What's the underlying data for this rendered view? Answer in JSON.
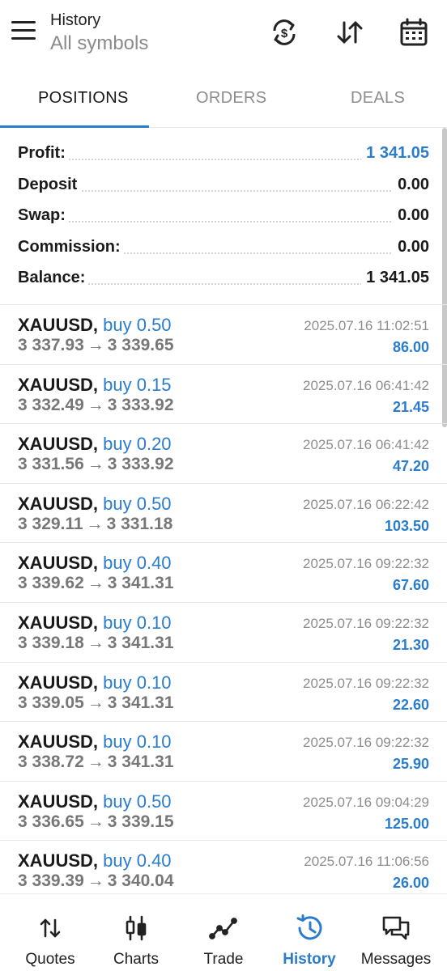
{
  "header": {
    "title": "History",
    "subtitle": "All symbols",
    "icons": [
      "menu-icon",
      "currency-exchange-icon",
      "sort-icon",
      "calendar-icon"
    ]
  },
  "tabs": [
    {
      "label": "POSITIONS",
      "active": true
    },
    {
      "label": "ORDERS",
      "active": false
    },
    {
      "label": "DEALS",
      "active": false
    }
  ],
  "summary": [
    {
      "label": "Profit:",
      "value": "1 341.05"
    },
    {
      "label": "Deposit",
      "value": "0.00"
    },
    {
      "label": "Swap:",
      "value": "0.00"
    },
    {
      "label": "Commission:",
      "value": "0.00"
    },
    {
      "label": "Balance:",
      "value": "1 341.05"
    }
  ],
  "positions": [
    {
      "symbol": "XAUUSD,",
      "type": "buy 0.50",
      "open": "3 337.93",
      "close": "3 339.65",
      "time": "2025.07.16 11:02:51",
      "profit": "86.00"
    },
    {
      "symbol": "XAUUSD,",
      "type": "buy 0.15",
      "open": "3 332.49",
      "close": "3 333.92",
      "time": "2025.07.16 06:41:42",
      "profit": "21.45"
    },
    {
      "symbol": "XAUUSD,",
      "type": "buy 0.20",
      "open": "3 331.56",
      "close": "3 333.92",
      "time": "2025.07.16 06:41:42",
      "profit": "47.20"
    },
    {
      "symbol": "XAUUSD,",
      "type": "buy 0.50",
      "open": "3 329.11",
      "close": "3 331.18",
      "time": "2025.07.16 06:22:42",
      "profit": "103.50"
    },
    {
      "symbol": "XAUUSD,",
      "type": "buy 0.40",
      "open": "3 339.62",
      "close": "3 341.31",
      "time": "2025.07.16 09:22:32",
      "profit": "67.60"
    },
    {
      "symbol": "XAUUSD,",
      "type": "buy 0.10",
      "open": "3 339.18",
      "close": "3 341.31",
      "time": "2025.07.16 09:22:32",
      "profit": "21.30"
    },
    {
      "symbol": "XAUUSD,",
      "type": "buy 0.10",
      "open": "3 339.05",
      "close": "3 341.31",
      "time": "2025.07.16 09:22:32",
      "profit": "22.60"
    },
    {
      "symbol": "XAUUSD,",
      "type": "buy 0.10",
      "open": "3 338.72",
      "close": "3 341.31",
      "time": "2025.07.16 09:22:32",
      "profit": "25.90"
    },
    {
      "symbol": "XAUUSD,",
      "type": "buy 0.50",
      "open": "3 336.65",
      "close": "3 339.15",
      "time": "2025.07.16 09:04:29",
      "profit": "125.00"
    },
    {
      "symbol": "XAUUSD,",
      "type": "buy 0.40",
      "open": "3 339.39",
      "close": "3 340.04",
      "time": "2025.07.16 11:06:56",
      "profit": "26.00"
    }
  ],
  "arrow": "→",
  "nav": [
    {
      "label": "Quotes",
      "icon": "quotes-icon",
      "active": false
    },
    {
      "label": "Charts",
      "icon": "charts-icon",
      "active": false
    },
    {
      "label": "Trade",
      "icon": "trade-icon",
      "active": false
    },
    {
      "label": "History",
      "icon": "history-icon",
      "active": true
    },
    {
      "label": "Messages",
      "icon": "messages-icon",
      "active": false
    }
  ],
  "colors": {
    "accent": "#2a7ccd",
    "muted": "#8d8d8d"
  }
}
